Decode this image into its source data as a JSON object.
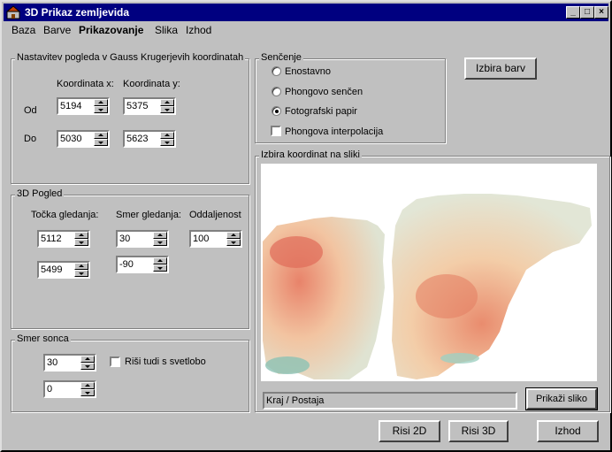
{
  "window": {
    "title": "3D Prikaz zemljevida"
  },
  "menu": [
    "Baza",
    "Barve",
    "Prikazovanje",
    "Slika",
    "Izhod"
  ],
  "view_group": {
    "title": "Nastavitev pogleda v Gauss Krugerjevih koordinatah",
    "col_x": "Koordinata x:",
    "col_y": "Koordinata y:",
    "from_label": "Od",
    "to_label": "Do",
    "from_x": "5194",
    "from_y": "5375",
    "to_x": "5030",
    "to_y": "5623"
  },
  "pogled3d": {
    "title": "3D Pogled",
    "tocka_label": "Točka gledanja:",
    "smer_label": "Smer gledanja:",
    "odd_label": "Oddaljenost",
    "tocka1": "5112",
    "tocka2": "5499",
    "smer1": "30",
    "smer2": "-90",
    "oddaljenost": "100"
  },
  "sonce": {
    "title": "Smer sonca",
    "val1": "30",
    "val2": "0",
    "check_label": "Riši tudi s svetlobo"
  },
  "sencenje": {
    "title": "Senčenje",
    "opt1": "Enostavno",
    "opt2": "Phongovo senčen",
    "opt3": "Fotografski papir",
    "check_label": "Phongova interpolacija",
    "selected": "Fotografski papir"
  },
  "izbira_barv": "Izbira barv",
  "image_group": {
    "title": "Izbira koordinat na sliki",
    "location_value": "Kraj / Postaja",
    "show_button": "Prikaži sliko"
  },
  "bottom": {
    "risi2d": "Risi 2D",
    "risi3d": "Risi 3D",
    "izhod": "Izhod"
  },
  "colors": {
    "titlebar": "#000080",
    "face": "#c0c0c0",
    "terrain_low": "#e8836a",
    "terrain_mid": "#f2c9a5",
    "terrain_high": "#dfe3d5",
    "terrain_teal": "#8cc2b4"
  }
}
